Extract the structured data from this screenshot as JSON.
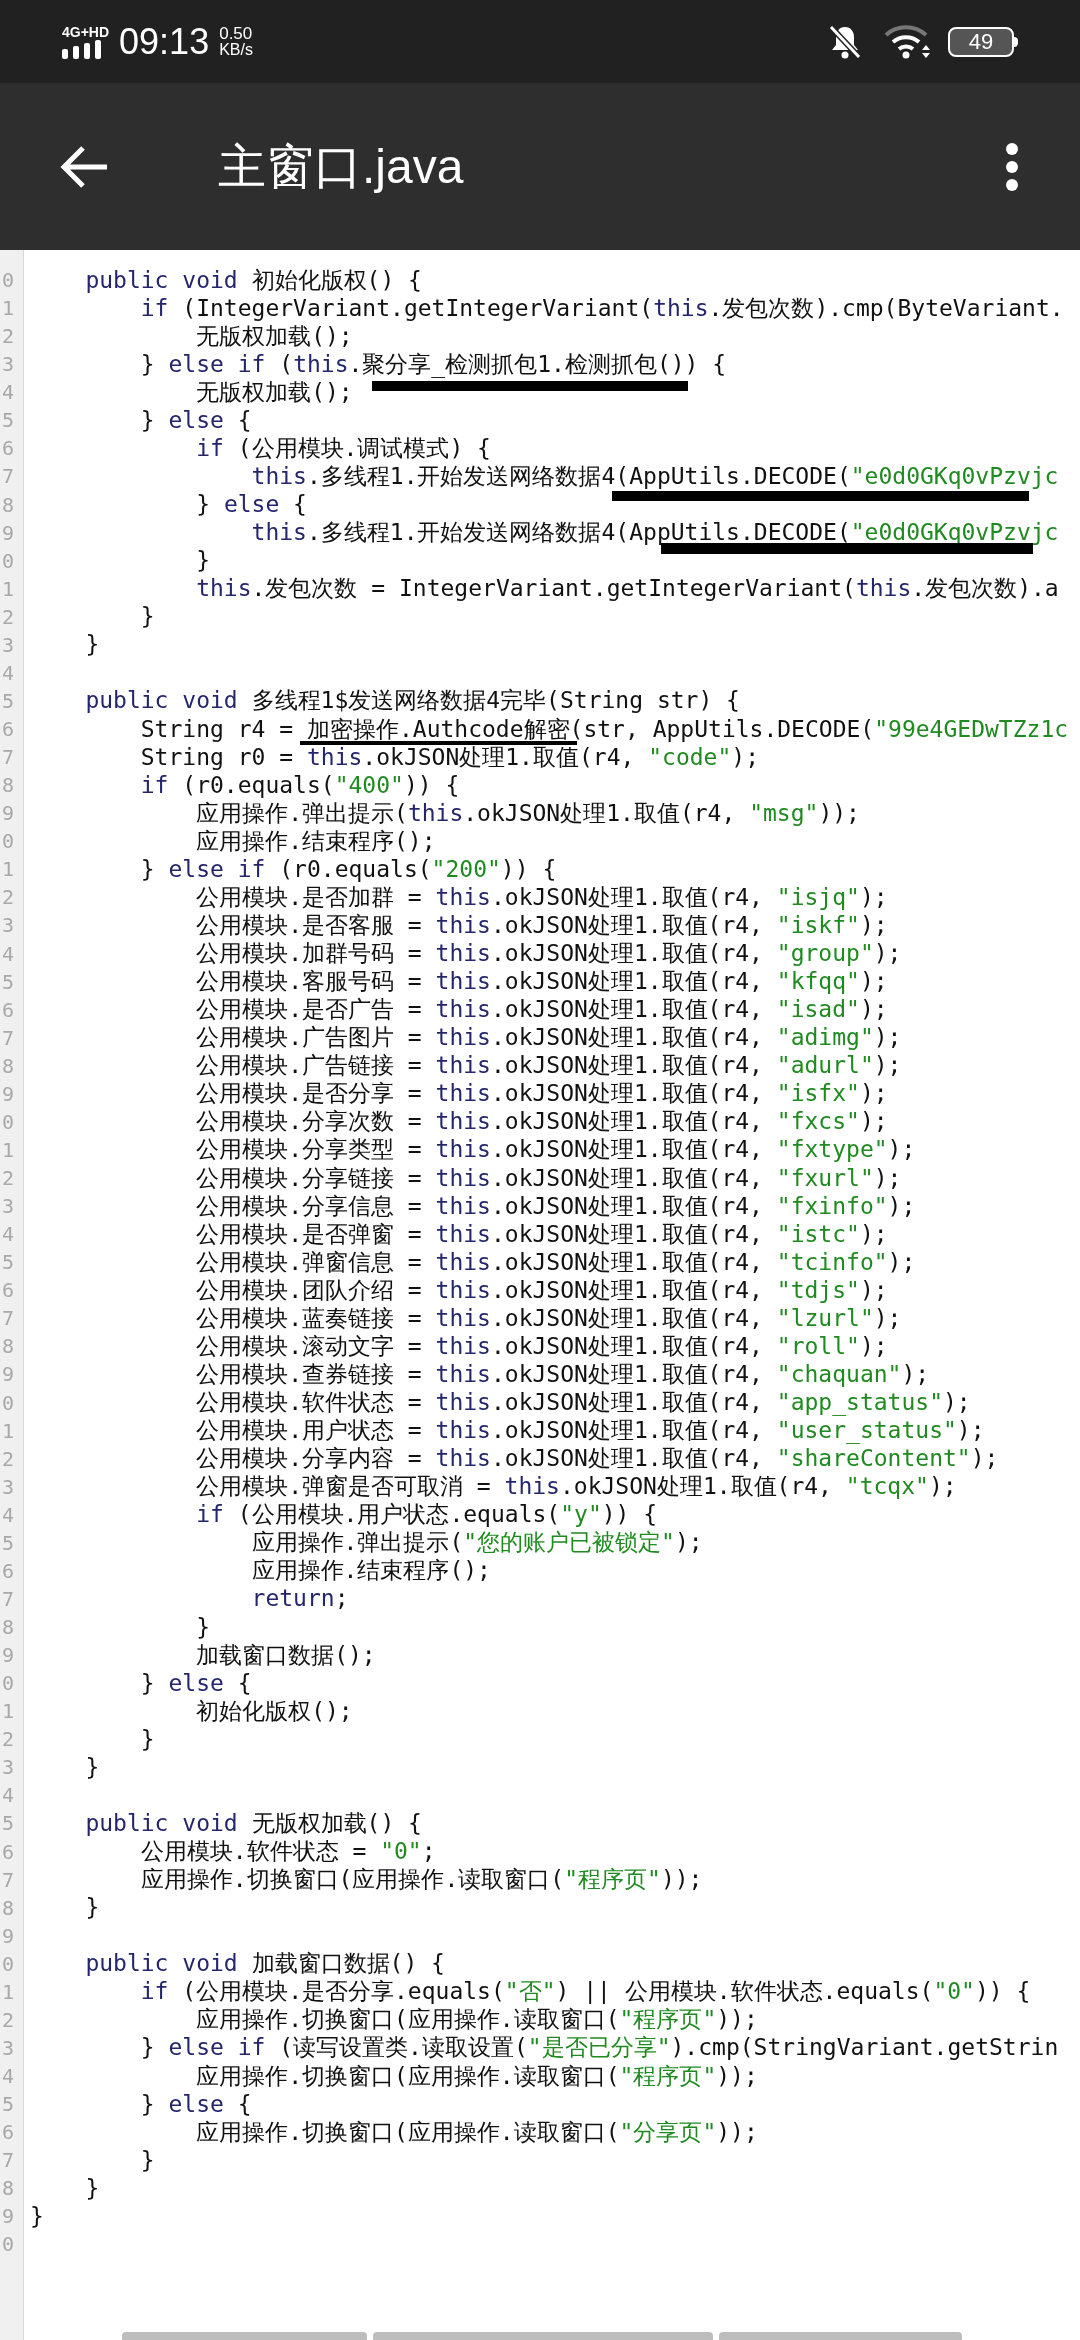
{
  "status_bar": {
    "network": "4G+HD",
    "time": "09:13",
    "speed_value": "0.50",
    "speed_unit": "KB/s",
    "battery": "49"
  },
  "app_bar": {
    "title": "主窗口.java"
  },
  "code": [
    {
      "number": "0",
      "segments": [
        {
          "kind": "kw",
          "text": "    public void"
        },
        {
          "kind": "plain",
          "text": " 初始化版权() {"
        }
      ]
    },
    {
      "number": "1",
      "segments": [
        {
          "kind": "kw",
          "text": "        if"
        },
        {
          "kind": "plain",
          "text": " (IntegerVariant.getIntegerVariant("
        },
        {
          "kind": "kw",
          "text": "this"
        },
        {
          "kind": "plain",
          "text": ".发包次数).cmp(ByteVariant."
        }
      ]
    },
    {
      "number": "2",
      "segments": [
        {
          "kind": "plain",
          "text": "            无版权加载();"
        }
      ]
    },
    {
      "number": "3",
      "segments": [
        {
          "kind": "plain",
          "text": "        } "
        },
        {
          "kind": "kw",
          "text": "else if"
        },
        {
          "kind": "plain",
          "text": " ("
        },
        {
          "kind": "kw",
          "text": "this"
        },
        {
          "kind": "plain",
          "text": ".聚分享_检测抓包1.检测抓包()) {"
        }
      ]
    },
    {
      "number": "4",
      "segments": [
        {
          "kind": "plain",
          "text": "            无版权加载();"
        }
      ]
    },
    {
      "number": "5",
      "segments": [
        {
          "kind": "plain",
          "text": "        } "
        },
        {
          "kind": "kw",
          "text": "else"
        },
        {
          "kind": "plain",
          "text": " {"
        }
      ]
    },
    {
      "number": "6",
      "segments": [
        {
          "kind": "kw",
          "text": "            if"
        },
        {
          "kind": "plain",
          "text": " (公用模块.调试模式) {"
        }
      ]
    },
    {
      "number": "7",
      "segments": [
        {
          "kind": "kw",
          "text": "                this"
        },
        {
          "kind": "plain",
          "text": ".多线程1.开始发送网络数据4(AppUtils.DECODE("
        },
        {
          "kind": "str",
          "text": "\"e0d0GKq0vPzvjc"
        }
      ]
    },
    {
      "number": "8",
      "segments": [
        {
          "kind": "plain",
          "text": "            } "
        },
        {
          "kind": "kw",
          "text": "else"
        },
        {
          "kind": "plain",
          "text": " {"
        }
      ]
    },
    {
      "number": "9",
      "segments": [
        {
          "kind": "kw",
          "text": "                this"
        },
        {
          "kind": "plain",
          "text": ".多线程1.开始发送网络数据4(AppUtils.DECODE("
        },
        {
          "kind": "str",
          "text": "\"e0d0GKq0vPzvjc"
        }
      ]
    },
    {
      "number": "0",
      "segments": [
        {
          "kind": "plain",
          "text": "            }"
        }
      ]
    },
    {
      "number": "1",
      "segments": [
        {
          "kind": "kw",
          "text": "            this"
        },
        {
          "kind": "plain",
          "text": ".发包次数 = IntegerVariant.getIntegerVariant("
        },
        {
          "kind": "kw",
          "text": "this"
        },
        {
          "kind": "plain",
          "text": ".发包次数).a"
        }
      ]
    },
    {
      "number": "2",
      "segments": [
        {
          "kind": "plain",
          "text": "        }"
        }
      ]
    },
    {
      "number": "3",
      "segments": [
        {
          "kind": "plain",
          "text": "    }"
        }
      ]
    },
    {
      "number": "4"
    },
    {
      "number": "5",
      "segments": [
        {
          "kind": "kw",
          "text": "    public void"
        },
        {
          "kind": "plain",
          "text": " 多线程1$发送网络数据4完毕(String str) {"
        }
      ]
    },
    {
      "number": "6",
      "segments": [
        {
          "kind": "plain",
          "text": "        String r4 = 加密操作.Authcode解密(str, AppUtils.DECODE("
        },
        {
          "kind": "str",
          "text": "\"99e4GEDwTZz1c"
        }
      ]
    },
    {
      "number": "7",
      "segments": [
        {
          "kind": "plain",
          "text": "        String r0 = "
        },
        {
          "kind": "kw",
          "text": "this"
        },
        {
          "kind": "plain",
          "text": ".okJSON处理1.取值(r4, "
        },
        {
          "kind": "str",
          "text": "\"code\""
        },
        {
          "kind": "plain",
          "text": ");"
        }
      ]
    },
    {
      "number": "8",
      "segments": [
        {
          "kind": "kw",
          "text": "        if"
        },
        {
          "kind": "plain",
          "text": " (r0.equals("
        },
        {
          "kind": "str",
          "text": "\"400\""
        },
        {
          "kind": "plain",
          "text": ")) {"
        }
      ]
    },
    {
      "number": "9",
      "segments": [
        {
          "kind": "plain",
          "text": "            应用操作.弹出提示("
        },
        {
          "kind": "kw",
          "text": "this"
        },
        {
          "kind": "plain",
          "text": ".okJSON处理1.取值(r4, "
        },
        {
          "kind": "str",
          "text": "\"msg\""
        },
        {
          "kind": "plain",
          "text": "));"
        }
      ]
    },
    {
      "number": "0",
      "segments": [
        {
          "kind": "plain",
          "text": "            应用操作.结束程序();"
        }
      ]
    },
    {
      "number": "1",
      "segments": [
        {
          "kind": "plain",
          "text": "        } "
        },
        {
          "kind": "kw",
          "text": "else if"
        },
        {
          "kind": "plain",
          "text": " (r0.equals("
        },
        {
          "kind": "str",
          "text": "\"200\""
        },
        {
          "kind": "plain",
          "text": ")) {"
        }
      ]
    },
    {
      "number": "2",
      "segments": [
        {
          "kind": "plain",
          "text": "            公用模块.是否加群 = "
        },
        {
          "kind": "kw",
          "text": "this"
        },
        {
          "kind": "plain",
          "text": ".okJSON处理1.取值(r4, "
        },
        {
          "kind": "str",
          "text": "\"isjq\""
        },
        {
          "kind": "plain",
          "text": ");"
        }
      ]
    },
    {
      "number": "3",
      "segments": [
        {
          "kind": "plain",
          "text": "            公用模块.是否客服 = "
        },
        {
          "kind": "kw",
          "text": "this"
        },
        {
          "kind": "plain",
          "text": ".okJSON处理1.取值(r4, "
        },
        {
          "kind": "str",
          "text": "\"iskf\""
        },
        {
          "kind": "plain",
          "text": ");"
        }
      ]
    },
    {
      "number": "4",
      "segments": [
        {
          "kind": "plain",
          "text": "            公用模块.加群号码 = "
        },
        {
          "kind": "kw",
          "text": "this"
        },
        {
          "kind": "plain",
          "text": ".okJSON处理1.取值(r4, "
        },
        {
          "kind": "str",
          "text": "\"group\""
        },
        {
          "kind": "plain",
          "text": ");"
        }
      ]
    },
    {
      "number": "5",
      "segments": [
        {
          "kind": "plain",
          "text": "            公用模块.客服号码 = "
        },
        {
          "kind": "kw",
          "text": "this"
        },
        {
          "kind": "plain",
          "text": ".okJSON处理1.取值(r4, "
        },
        {
          "kind": "str",
          "text": "\"kfqq\""
        },
        {
          "kind": "plain",
          "text": ");"
        }
      ]
    },
    {
      "number": "6",
      "segments": [
        {
          "kind": "plain",
          "text": "            公用模块.是否广告 = "
        },
        {
          "kind": "kw",
          "text": "this"
        },
        {
          "kind": "plain",
          "text": ".okJSON处理1.取值(r4, "
        },
        {
          "kind": "str",
          "text": "\"isad\""
        },
        {
          "kind": "plain",
          "text": ");"
        }
      ]
    },
    {
      "number": "7",
      "segments": [
        {
          "kind": "plain",
          "text": "            公用模块.广告图片 = "
        },
        {
          "kind": "kw",
          "text": "this"
        },
        {
          "kind": "plain",
          "text": ".okJSON处理1.取值(r4, "
        },
        {
          "kind": "str",
          "text": "\"adimg\""
        },
        {
          "kind": "plain",
          "text": ");"
        }
      ]
    },
    {
      "number": "8",
      "segments": [
        {
          "kind": "plain",
          "text": "            公用模块.广告链接 = "
        },
        {
          "kind": "kw",
          "text": "this"
        },
        {
          "kind": "plain",
          "text": ".okJSON处理1.取值(r4, "
        },
        {
          "kind": "str",
          "text": "\"adurl\""
        },
        {
          "kind": "plain",
          "text": ");"
        }
      ]
    },
    {
      "number": "9",
      "segments": [
        {
          "kind": "plain",
          "text": "            公用模块.是否分享 = "
        },
        {
          "kind": "kw",
          "text": "this"
        },
        {
          "kind": "plain",
          "text": ".okJSON处理1.取值(r4, "
        },
        {
          "kind": "str",
          "text": "\"isfx\""
        },
        {
          "kind": "plain",
          "text": ");"
        }
      ]
    },
    {
      "number": "0",
      "segments": [
        {
          "kind": "plain",
          "text": "            公用模块.分享次数 = "
        },
        {
          "kind": "kw",
          "text": "this"
        },
        {
          "kind": "plain",
          "text": ".okJSON处理1.取值(r4, "
        },
        {
          "kind": "str",
          "text": "\"fxcs\""
        },
        {
          "kind": "plain",
          "text": ");"
        }
      ]
    },
    {
      "number": "1",
      "segments": [
        {
          "kind": "plain",
          "text": "            公用模块.分享类型 = "
        },
        {
          "kind": "kw",
          "text": "this"
        },
        {
          "kind": "plain",
          "text": ".okJSON处理1.取值(r4, "
        },
        {
          "kind": "str",
          "text": "\"fxtype\""
        },
        {
          "kind": "plain",
          "text": ");"
        }
      ]
    },
    {
      "number": "2",
      "segments": [
        {
          "kind": "plain",
          "text": "            公用模块.分享链接 = "
        },
        {
          "kind": "kw",
          "text": "this"
        },
        {
          "kind": "plain",
          "text": ".okJSON处理1.取值(r4, "
        },
        {
          "kind": "str",
          "text": "\"fxurl\""
        },
        {
          "kind": "plain",
          "text": ");"
        }
      ]
    },
    {
      "number": "3",
      "segments": [
        {
          "kind": "plain",
          "text": "            公用模块.分享信息 = "
        },
        {
          "kind": "kw",
          "text": "this"
        },
        {
          "kind": "plain",
          "text": ".okJSON处理1.取值(r4, "
        },
        {
          "kind": "str",
          "text": "\"fxinfo\""
        },
        {
          "kind": "plain",
          "text": ");"
        }
      ]
    },
    {
      "number": "4",
      "segments": [
        {
          "kind": "plain",
          "text": "            公用模块.是否弹窗 = "
        },
        {
          "kind": "kw",
          "text": "this"
        },
        {
          "kind": "plain",
          "text": ".okJSON处理1.取值(r4, "
        },
        {
          "kind": "str",
          "text": "\"istc\""
        },
        {
          "kind": "plain",
          "text": ");"
        }
      ]
    },
    {
      "number": "5",
      "segments": [
        {
          "kind": "plain",
          "text": "            公用模块.弹窗信息 = "
        },
        {
          "kind": "kw",
          "text": "this"
        },
        {
          "kind": "plain",
          "text": ".okJSON处理1.取值(r4, "
        },
        {
          "kind": "str",
          "text": "\"tcinfo\""
        },
        {
          "kind": "plain",
          "text": ");"
        }
      ]
    },
    {
      "number": "6",
      "segments": [
        {
          "kind": "plain",
          "text": "            公用模块.团队介绍 = "
        },
        {
          "kind": "kw",
          "text": "this"
        },
        {
          "kind": "plain",
          "text": ".okJSON处理1.取值(r4, "
        },
        {
          "kind": "str",
          "text": "\"tdjs\""
        },
        {
          "kind": "plain",
          "text": ");"
        }
      ]
    },
    {
      "number": "7",
      "segments": [
        {
          "kind": "plain",
          "text": "            公用模块.蓝奏链接 = "
        },
        {
          "kind": "kw",
          "text": "this"
        },
        {
          "kind": "plain",
          "text": ".okJSON处理1.取值(r4, "
        },
        {
          "kind": "str",
          "text": "\"lzurl\""
        },
        {
          "kind": "plain",
          "text": ");"
        }
      ]
    },
    {
      "number": "8",
      "segments": [
        {
          "kind": "plain",
          "text": "            公用模块.滚动文字 = "
        },
        {
          "kind": "kw",
          "text": "this"
        },
        {
          "kind": "plain",
          "text": ".okJSON处理1.取值(r4, "
        },
        {
          "kind": "str",
          "text": "\"roll\""
        },
        {
          "kind": "plain",
          "text": ");"
        }
      ]
    },
    {
      "number": "9",
      "segments": [
        {
          "kind": "plain",
          "text": "            公用模块.查券链接 = "
        },
        {
          "kind": "kw",
          "text": "this"
        },
        {
          "kind": "plain",
          "text": ".okJSON处理1.取值(r4, "
        },
        {
          "kind": "str",
          "text": "\"chaquan\""
        },
        {
          "kind": "plain",
          "text": ");"
        }
      ]
    },
    {
      "number": "0",
      "segments": [
        {
          "kind": "plain",
          "text": "            公用模块.软件状态 = "
        },
        {
          "kind": "kw",
          "text": "this"
        },
        {
          "kind": "plain",
          "text": ".okJSON处理1.取值(r4, "
        },
        {
          "kind": "str",
          "text": "\"app_status\""
        },
        {
          "kind": "plain",
          "text": ");"
        }
      ]
    },
    {
      "number": "1",
      "segments": [
        {
          "kind": "plain",
          "text": "            公用模块.用户状态 = "
        },
        {
          "kind": "kw",
          "text": "this"
        },
        {
          "kind": "plain",
          "text": ".okJSON处理1.取值(r4, "
        },
        {
          "kind": "str",
          "text": "\"user_status\""
        },
        {
          "kind": "plain",
          "text": ");"
        }
      ]
    },
    {
      "number": "2",
      "segments": [
        {
          "kind": "plain",
          "text": "            公用模块.分享内容 = "
        },
        {
          "kind": "kw",
          "text": "this"
        },
        {
          "kind": "plain",
          "text": ".okJSON处理1.取值(r4, "
        },
        {
          "kind": "str",
          "text": "\"shareContent\""
        },
        {
          "kind": "plain",
          "text": ");"
        }
      ]
    },
    {
      "number": "3",
      "segments": [
        {
          "kind": "plain",
          "text": "            公用模块.弹窗是否可取消 = "
        },
        {
          "kind": "kw",
          "text": "this"
        },
        {
          "kind": "plain",
          "text": ".okJSON处理1.取值(r4, "
        },
        {
          "kind": "str",
          "text": "\"tcqx\""
        },
        {
          "kind": "plain",
          "text": ");"
        }
      ]
    },
    {
      "number": "4",
      "segments": [
        {
          "kind": "kw",
          "text": "            if"
        },
        {
          "kind": "plain",
          "text": " (公用模块.用户状态.equals("
        },
        {
          "kind": "str",
          "text": "\"y\""
        },
        {
          "kind": "plain",
          "text": ")) {"
        }
      ]
    },
    {
      "number": "5",
      "segments": [
        {
          "kind": "plain",
          "text": "                应用操作.弹出提示("
        },
        {
          "kind": "str",
          "text": "\"您的账户已被锁定\""
        },
        {
          "kind": "plain",
          "text": ");"
        }
      ]
    },
    {
      "number": "6",
      "segments": [
        {
          "kind": "plain",
          "text": "                应用操作.结束程序();"
        }
      ]
    },
    {
      "number": "7",
      "segments": [
        {
          "kind": "kw",
          "text": "                return"
        },
        {
          "kind": "plain",
          "text": ";"
        }
      ]
    },
    {
      "number": "8",
      "segments": [
        {
          "kind": "plain",
          "text": "            }"
        }
      ]
    },
    {
      "number": "9",
      "segments": [
        {
          "kind": "plain",
          "text": "            加载窗口数据();"
        }
      ]
    },
    {
      "number": "0",
      "segments": [
        {
          "kind": "plain",
          "text": "        } "
        },
        {
          "kind": "kw",
          "text": "else"
        },
        {
          "kind": "plain",
          "text": " {"
        }
      ]
    },
    {
      "number": "1",
      "segments": [
        {
          "kind": "plain",
          "text": "            初始化版权();"
        }
      ]
    },
    {
      "number": "2",
      "segments": [
        {
          "kind": "plain",
          "text": "        }"
        }
      ]
    },
    {
      "number": "3",
      "segments": [
        {
          "kind": "plain",
          "text": "    }"
        }
      ]
    },
    {
      "number": "4"
    },
    {
      "number": "5",
      "segments": [
        {
          "kind": "kw",
          "text": "    public void"
        },
        {
          "kind": "plain",
          "text": " 无版权加载() {"
        }
      ]
    },
    {
      "number": "6",
      "segments": [
        {
          "kind": "plain",
          "text": "        公用模块.软件状态 = "
        },
        {
          "kind": "str",
          "text": "\"0\""
        },
        {
          "kind": "plain",
          "text": ";"
        }
      ]
    },
    {
      "number": "7",
      "segments": [
        {
          "kind": "plain",
          "text": "        应用操作.切换窗口(应用操作.读取窗口("
        },
        {
          "kind": "str",
          "text": "\"程序页\""
        },
        {
          "kind": "plain",
          "text": "));"
        }
      ]
    },
    {
      "number": "8",
      "segments": [
        {
          "kind": "plain",
          "text": "    }"
        }
      ]
    },
    {
      "number": "9"
    },
    {
      "number": "0",
      "segments": [
        {
          "kind": "kw",
          "text": "    public void"
        },
        {
          "kind": "plain",
          "text": " 加载窗口数据() {"
        }
      ]
    },
    {
      "number": "1",
      "segments": [
        {
          "kind": "kw",
          "text": "        if"
        },
        {
          "kind": "plain",
          "text": " (公用模块.是否分享.equals("
        },
        {
          "kind": "str",
          "text": "\"否\""
        },
        {
          "kind": "plain",
          "text": ") || 公用模块.软件状态.equals("
        },
        {
          "kind": "str",
          "text": "\"0\""
        },
        {
          "kind": "plain",
          "text": ")) {"
        }
      ]
    },
    {
      "number": "2",
      "segments": [
        {
          "kind": "plain",
          "text": "            应用操作.切换窗口(应用操作.读取窗口("
        },
        {
          "kind": "str",
          "text": "\"程序页\""
        },
        {
          "kind": "plain",
          "text": "));"
        }
      ]
    },
    {
      "number": "3",
      "segments": [
        {
          "kind": "plain",
          "text": "        } "
        },
        {
          "kind": "kw",
          "text": "else if"
        },
        {
          "kind": "plain",
          "text": " (读写设置类.读取设置("
        },
        {
          "kind": "str",
          "text": "\"是否已分享\""
        },
        {
          "kind": "plain",
          "text": ").cmp(StringVariant.getStrin"
        }
      ]
    },
    {
      "number": "4",
      "segments": [
        {
          "kind": "plain",
          "text": "            应用操作.切换窗口(应用操作.读取窗口("
        },
        {
          "kind": "str",
          "text": "\"程序页\""
        },
        {
          "kind": "plain",
          "text": "));"
        }
      ]
    },
    {
      "number": "5",
      "segments": [
        {
          "kind": "plain",
          "text": "        } "
        },
        {
          "kind": "kw",
          "text": "else"
        },
        {
          "kind": "plain",
          "text": " {"
        }
      ]
    },
    {
      "number": "6",
      "segments": [
        {
          "kind": "plain",
          "text": "            应用操作.切换窗口(应用操作.读取窗口("
        },
        {
          "kind": "str",
          "text": "\"分享页\""
        },
        {
          "kind": "plain",
          "text": "));"
        }
      ]
    },
    {
      "number": "7",
      "segments": [
        {
          "kind": "plain",
          "text": "        }"
        }
      ]
    },
    {
      "number": "8",
      "segments": [
        {
          "kind": "plain",
          "text": "    }"
        }
      ]
    },
    {
      "number": "9",
      "segments": [
        {
          "kind": "plain",
          "text": "}"
        }
      ]
    },
    {
      "number": "0"
    }
  ]
}
